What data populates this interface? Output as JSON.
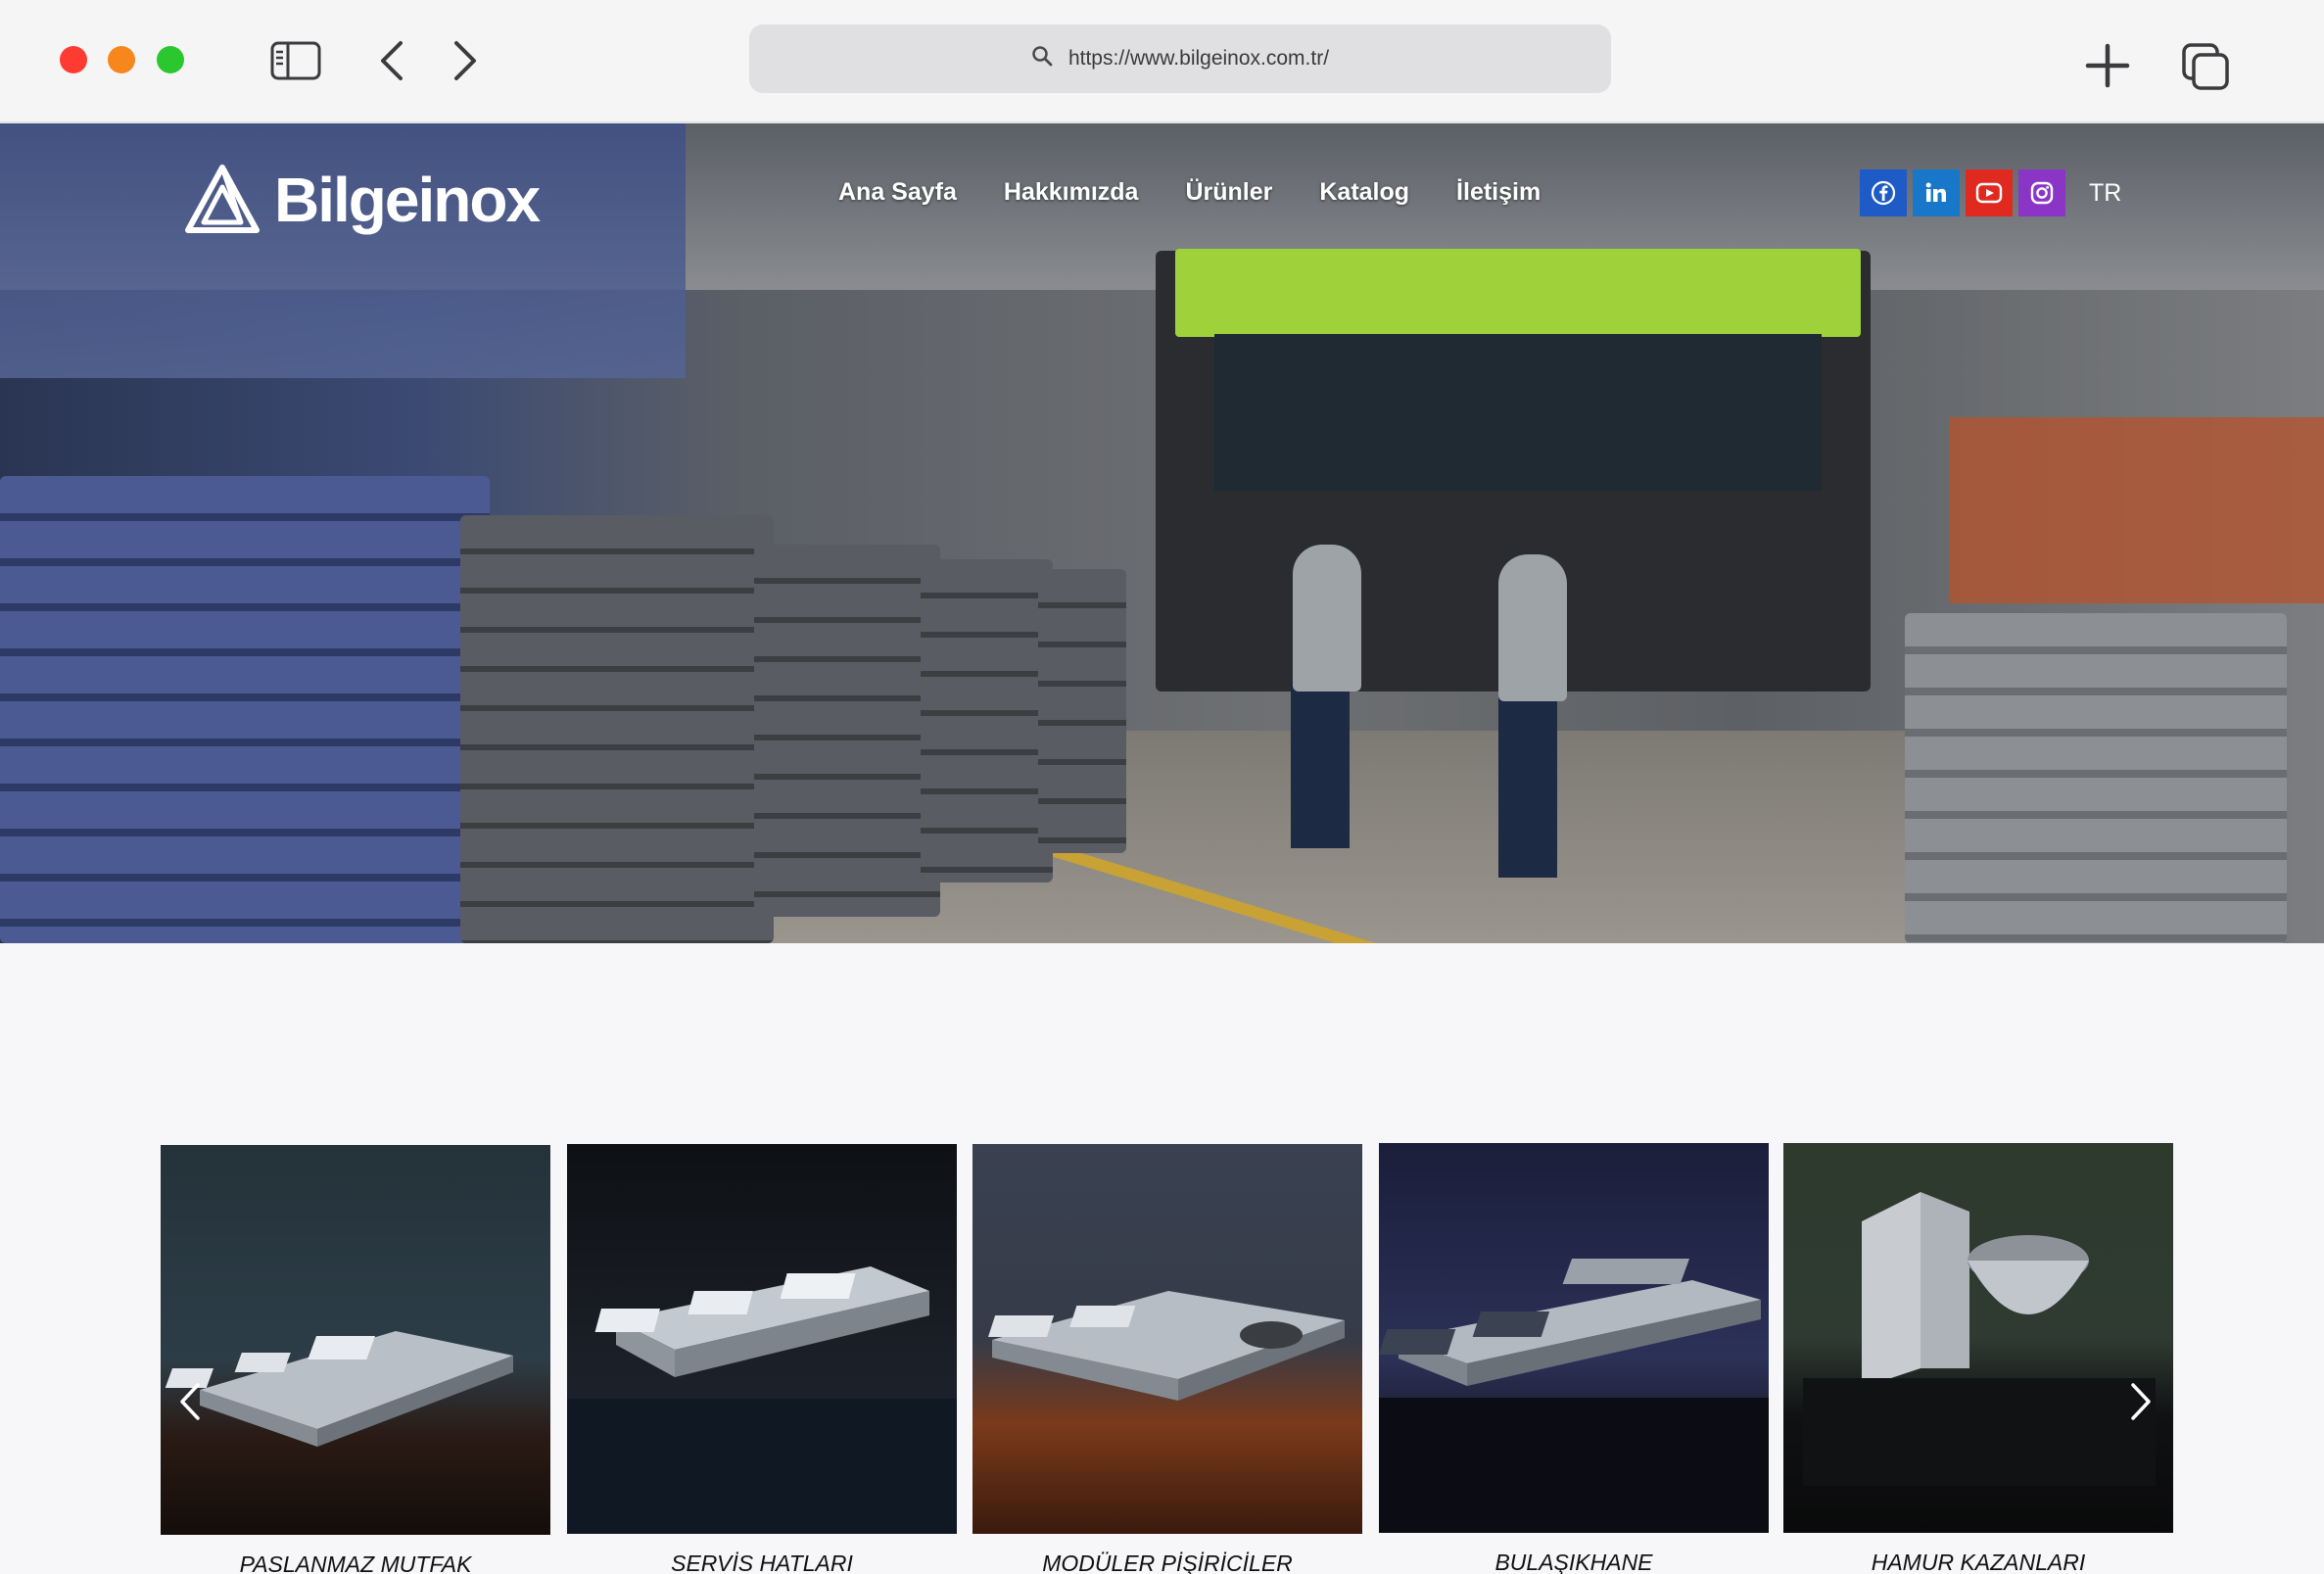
{
  "browser": {
    "url": "https://www.bilgeinox.com.tr/"
  },
  "site": {
    "logo_text": "Bilgeinox",
    "nav": [
      "Ana Sayfa",
      "Hakkımızda",
      "Ürünler",
      "Katalog",
      "İletişim"
    ],
    "social": [
      {
        "name": "facebook",
        "color": "#1877f2",
        "bg": "#1e5bc6"
      },
      {
        "name": "linkedin",
        "color": "#0a66c2",
        "bg": "#1877c9"
      },
      {
        "name": "youtube",
        "color": "#e62117",
        "bg": "#e02a20"
      },
      {
        "name": "instagram",
        "color": "#7b2fc4",
        "bg": "#8a35c6"
      }
    ],
    "language": "TR"
  },
  "products": [
    {
      "label": "PASLANMAZ MUTFAK AKSESUARLARI"
    },
    {
      "label": "SERVİS HATLARI"
    },
    {
      "label": "MODÜLER PİŞİRİCİLER"
    },
    {
      "label": "BULAŞIKHANE"
    },
    {
      "label": "HAMUR KAZANLARI"
    }
  ],
  "carousel": {
    "page_count": 2,
    "active_page": 1,
    "active_color": "#2c35b8",
    "inactive_color": "#cfd1ee"
  }
}
